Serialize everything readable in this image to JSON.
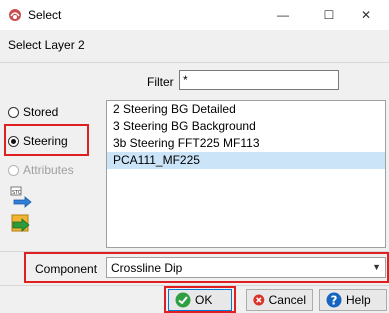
{
  "window": {
    "title": "Select",
    "minimize_glyph": "—",
    "maximize_glyph": "☐",
    "close_glyph": "✕"
  },
  "subtitle": "Select Layer 2",
  "filter": {
    "label": "Filter",
    "value": "*"
  },
  "radios": {
    "stored": {
      "label": "Stored",
      "checked": false
    },
    "steering": {
      "label": "Steering",
      "checked": true
    },
    "attributes": {
      "label": "Attributes",
      "checked": false,
      "disabled": true
    }
  },
  "list": {
    "items": [
      {
        "label": "2 Steering BG Detailed",
        "selected": false
      },
      {
        "label": "3 Steering BG Background",
        "selected": false
      },
      {
        "label": "3b Steering FFT225 MF113",
        "selected": false
      },
      {
        "label": "PCA111_MF225",
        "selected": true
      }
    ]
  },
  "component": {
    "label": "Component",
    "value": "Crossline Dip"
  },
  "buttons": {
    "ok": "OK",
    "cancel": "Cancel",
    "help": "Help"
  },
  "colors": {
    "highlight": "#e02020",
    "selection": "#cce4f7",
    "ok_green": "#2ea043",
    "cancel_red": "#d9342b",
    "help_blue": "#1565c0"
  }
}
